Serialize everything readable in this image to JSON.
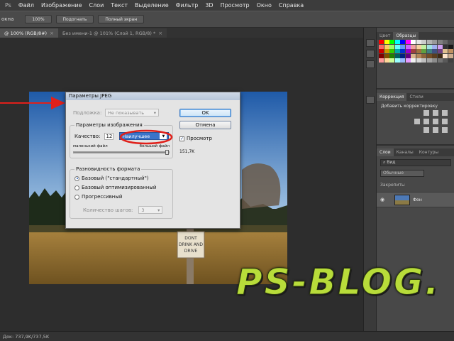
{
  "menu": {
    "left_cut": "Ps",
    "items": [
      "Файл",
      "Изображение",
      "Слои",
      "Текст",
      "Выделение",
      "Фильтр",
      "3D",
      "Просмотр",
      "Окно",
      "Справка"
    ]
  },
  "options_bar": {
    "label": "окна",
    "buttons": [
      "100%",
      "Подогнать",
      "Полный экран"
    ]
  },
  "tabs": [
    {
      "label": "@ 100% (RGB/8#)",
      "active": true
    },
    {
      "label": "Без имени-1 @ 101% (Слой 1, RGB/8) *",
      "active": false
    }
  ],
  "dialog": {
    "title": "Параметры JPEG",
    "matte_label": "Подложка:",
    "matte_value": "Не показывать",
    "image_options": {
      "legend": "Параметры изображения",
      "quality_label": "Качество:",
      "quality_value": "12",
      "quality_select": "Наилучшее",
      "small_file": "маленький файл",
      "large_file": "большой файл",
      "quality_level": 1.0
    },
    "format_options": {
      "legend": "Разновидность формата",
      "options": [
        "Базовый (\"стандартный\")",
        "Базовый оптимизированный",
        "Прогрессивный"
      ],
      "selected_index": 0,
      "scans_label": "Количество шагов:",
      "scans_value": "3"
    },
    "ok_label": "OK",
    "cancel_label": "Отмена",
    "preview_label": "Просмотр",
    "preview_checked": true,
    "file_size": "151,7K"
  },
  "canvas_sign": {
    "line1": "DONT",
    "line2": "DRINK AND",
    "line3": "DRIVE"
  },
  "right_panel": {
    "color_tabs": [
      "Цвет",
      "Образцы"
    ],
    "adjust_tabs": [
      "Коррекция",
      "Стили"
    ],
    "adjust_title": "Добавить корректировку",
    "layer_tabs": [
      "Слои",
      "Каналы",
      "Контуры"
    ],
    "search_placeholder": "Вид",
    "blend_mode": "Обычные",
    "lock_label": "Закрепить:",
    "layer_name": "Фон"
  },
  "watermark": "PS-BLOG.",
  "status": "Док: 737,9K/737,5K",
  "colors": {
    "accent_red": "#e0201a",
    "selection_blue": "#3b74c9",
    "watermark_green": "#b8dc3a"
  }
}
